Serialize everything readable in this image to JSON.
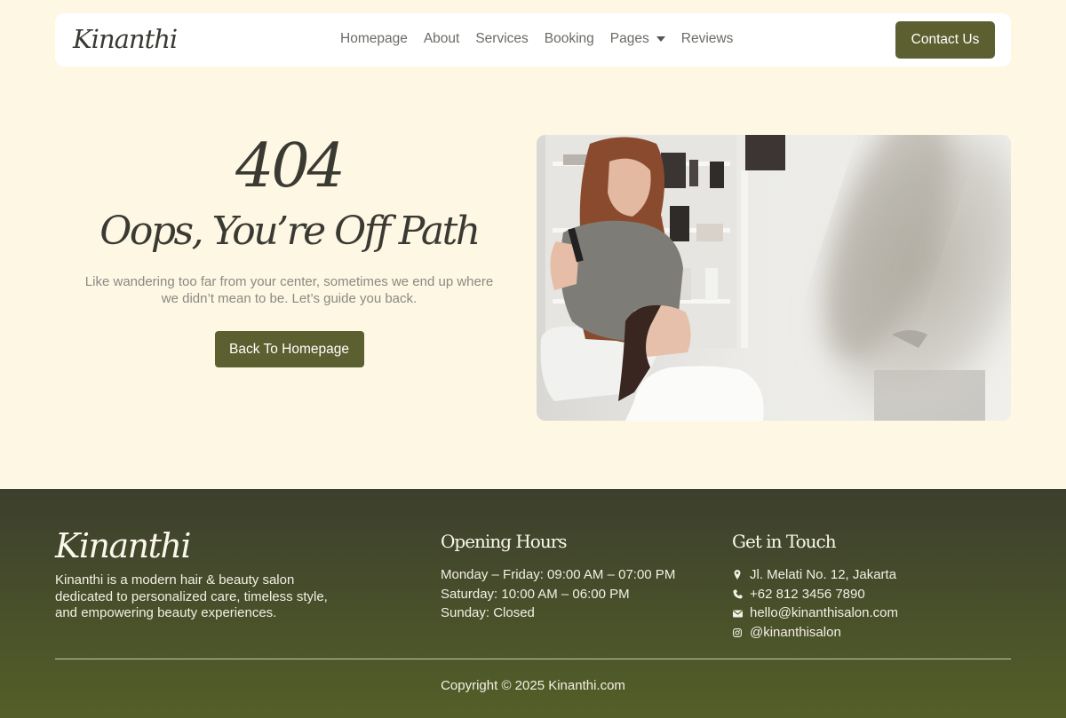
{
  "brand": {
    "name": "Kinanthi"
  },
  "nav": {
    "items": [
      {
        "label": "Homepage"
      },
      {
        "label": "About"
      },
      {
        "label": "Services"
      },
      {
        "label": "Booking"
      },
      {
        "label": "Pages"
      },
      {
        "label": "Reviews"
      }
    ],
    "contact_label": "Contact Us"
  },
  "hero": {
    "code": "404",
    "title": "Oops, You’re Off Path",
    "description": "Like wandering too far from your center, sometimes we end up where we didn’t mean to be. Let’s guide you back.",
    "button_label": "Back To Homepage"
  },
  "footer": {
    "brand": "Kinanthi",
    "description": "Kinanthi is a modern hair & beauty salon dedicated to personalized care, timeless style, and empowering beauty experiences.",
    "hours": {
      "title": "Opening Hours",
      "lines": [
        "Monday – Friday: 09:00 AM – 07:00 PM",
        "Saturday: 10:00 AM – 06:00 PM",
        "Sunday: Closed"
      ]
    },
    "contact": {
      "title": "Get in Touch",
      "address": {
        "icon": "map-pin-icon",
        "text": "Jl. Melati No. 12, Jakarta"
      },
      "phone": {
        "icon": "phone-icon",
        "text": "+62 812 3456 7890"
      },
      "email": {
        "icon": "mail-icon",
        "text": "hello@kinanthisalon.com"
      },
      "instagram": {
        "icon": "instagram-icon",
        "text": "@kinanthisalon"
      }
    },
    "copyright": "Copyright © 2025 Kinanthi.com"
  },
  "colors": {
    "background": "#fdf7e3",
    "accent": "#5c6030",
    "footer_top": "#3c3f2d",
    "footer_bottom": "#545f28"
  }
}
